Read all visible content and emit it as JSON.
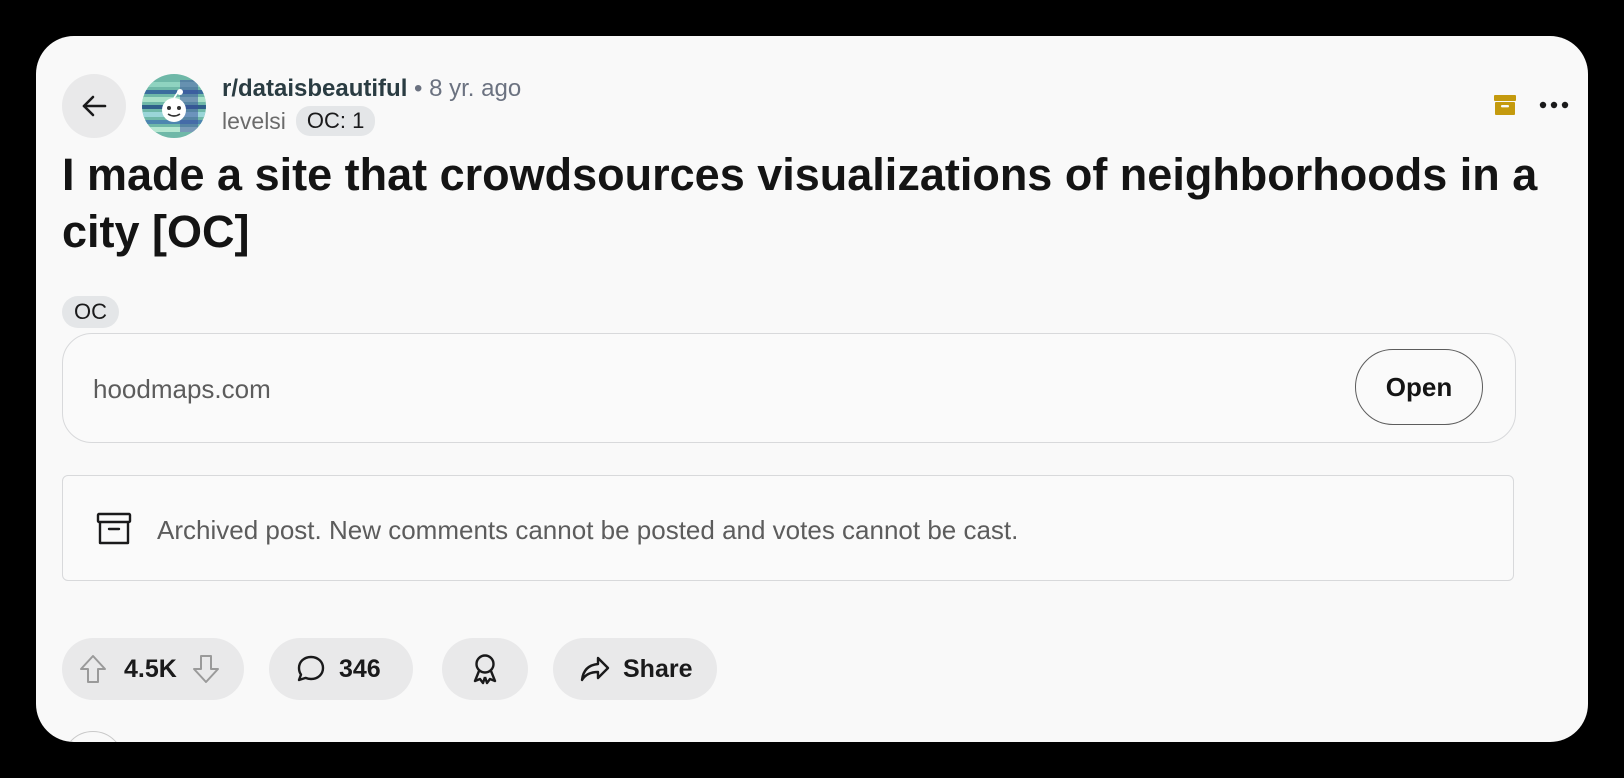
{
  "header": {
    "subreddit": "r/dataisbeautiful",
    "time": "• 8 yr. ago",
    "author": "levelsi",
    "user_flair": "OC: 1"
  },
  "post": {
    "title": "I made a site that crowdsources visualizations of neighborhoods in a city [OC]",
    "flair": "OC"
  },
  "link": {
    "domain": "hoodmaps.com",
    "open_label": "Open"
  },
  "notice": {
    "text": "Archived post. New comments cannot be posted and votes cannot be cast."
  },
  "actions": {
    "score": "4.5K",
    "comments": "346",
    "share_label": "Share"
  },
  "icons": {
    "back": "arrow-left-icon",
    "archive": "archive-box-icon",
    "more": "ellipsis-icon",
    "upvote": "arrow-up-icon",
    "downvote": "arrow-down-icon",
    "comment": "speech-bubble-icon",
    "award": "award-ribbon-icon",
    "share": "share-arrow-icon"
  },
  "colors": {
    "archive_accent": "#c49a0e",
    "background": "#f9f9f9",
    "pill": "#e9e9ea"
  }
}
